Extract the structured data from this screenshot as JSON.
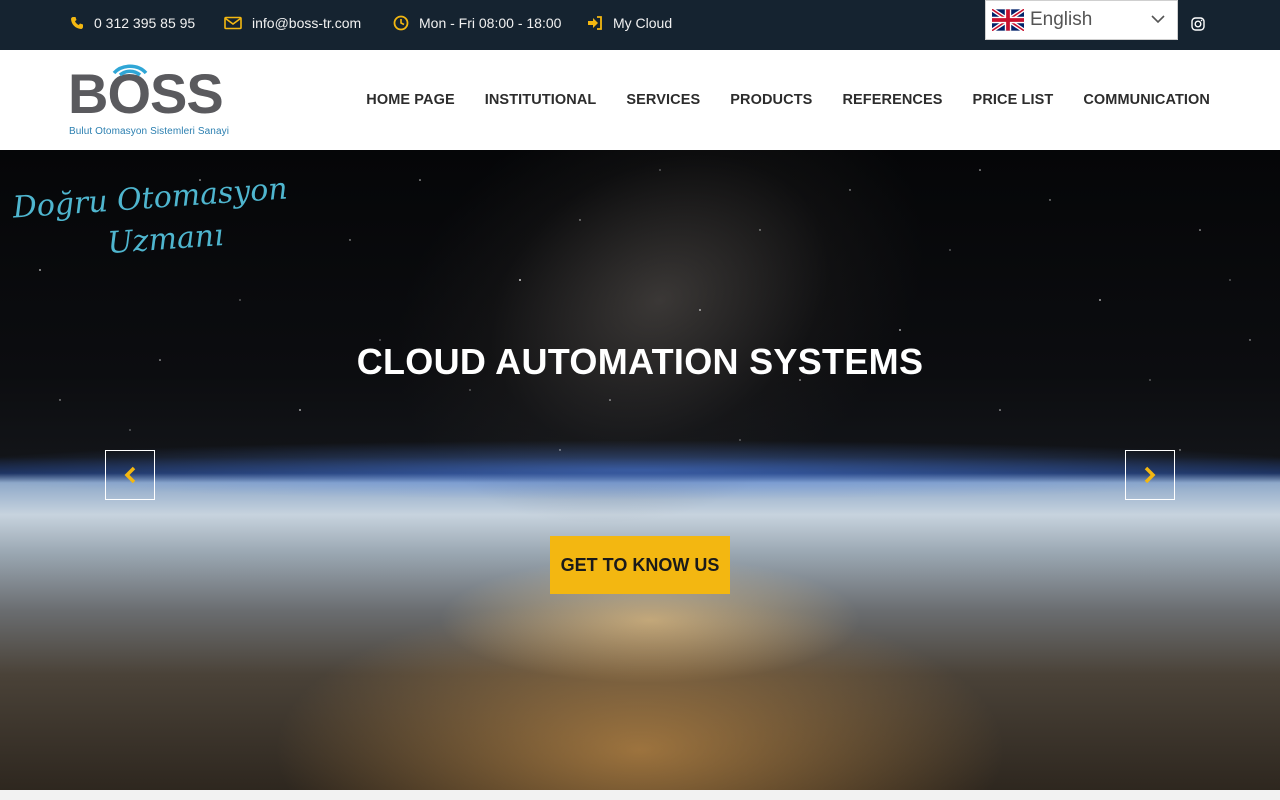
{
  "topbar": {
    "phone": "0 312 395 85 95",
    "email": "info@boss-tr.com",
    "hours": "Mon - Fri 08:00 - 18:00",
    "cloud_link": "My Cloud",
    "language": "English",
    "icon_color": "#f3b711"
  },
  "header": {
    "logo_text": "BOSS",
    "logo_subtitle": "Bulut Otomasyon Sistemleri Sanayi",
    "nav": [
      "HOME PAGE",
      "INSTITUTIONAL",
      "SERVICES",
      "PRODUCTS",
      "REFERENCES",
      "PRICE LIST",
      "COMMUNICATION"
    ]
  },
  "hero": {
    "script_line1": "Doğru Otomasyon",
    "script_line2": "Uzmanı",
    "title": "CLOUD AUTOMATION SYSTEMS",
    "cta": "GET TO KNOW US",
    "accent_color": "#f3b711"
  }
}
